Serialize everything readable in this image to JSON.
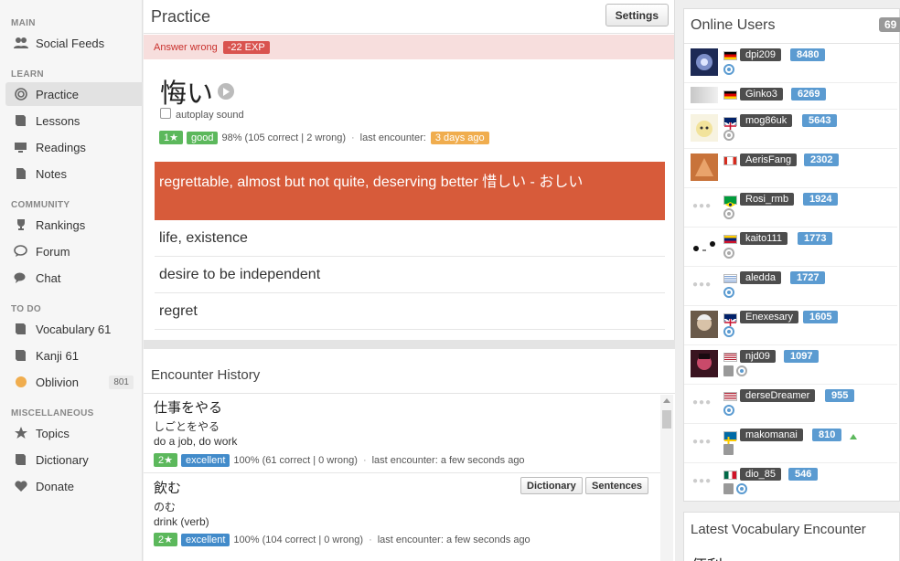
{
  "sidebar": {
    "sections": [
      {
        "title": "MAIN"
      },
      {
        "title": "LEARN"
      },
      {
        "title": "COMMUNITY"
      },
      {
        "title": "TO DO"
      },
      {
        "title": "MISCELLANEOUS"
      }
    ],
    "items": [
      {
        "label": "Social Feeds",
        "icon": "users-icon"
      },
      {
        "label": "Practice",
        "icon": "target-icon",
        "active": true
      },
      {
        "label": "Lessons",
        "icon": "book-icon"
      },
      {
        "label": "Readings",
        "icon": "monitor-icon"
      },
      {
        "label": "Notes",
        "icon": "document-icon"
      },
      {
        "label": "Rankings",
        "icon": "trophy-icon"
      },
      {
        "label": "Forum",
        "icon": "comment-icon"
      },
      {
        "label": "Chat",
        "icon": "comments-icon"
      },
      {
        "label": "Vocabulary 61",
        "icon": "book-icon"
      },
      {
        "label": "Kanji 61",
        "icon": "book-icon"
      },
      {
        "label": "Oblivion",
        "icon": "circle-icon",
        "count": "801"
      },
      {
        "label": "Topics",
        "icon": "star-icon"
      },
      {
        "label": "Dictionary",
        "icon": "book-icon"
      },
      {
        "label": "Donate",
        "icon": "heart-icon"
      }
    ]
  },
  "practice": {
    "title": "Practice",
    "settings_label": "Settings",
    "result_text": "Answer wrong",
    "exp_badge": "-22 EXP",
    "word": "悔い",
    "autoplay_label": "autoplay sound",
    "level_badge": "1★",
    "quality_badge": "good",
    "stats_text": "98% (105 correct | 2 wrong)",
    "last_label": "last encounter:",
    "last_value": "3 days ago",
    "answers": [
      {
        "text": "regrettable, almost but not quite, deserving better  惜しい - おしい",
        "correct": true
      },
      {
        "text": "life, existence"
      },
      {
        "text": "desire to be independent"
      },
      {
        "text": "regret"
      }
    ]
  },
  "history": {
    "title": "Encounter History",
    "items": [
      {
        "word": "仕事をやる",
        "reading": "しごとをやる",
        "meaning": "do a job, do work",
        "level": "2★",
        "quality": "excellent",
        "stats": "100% (61 correct | 0 wrong)",
        "last": "last encounter: a few seconds ago"
      },
      {
        "word": "飲む",
        "reading": "のむ",
        "meaning": "drink (verb)",
        "level": "2★",
        "quality": "excellent",
        "stats": "100% (104 correct | 0 wrong)",
        "last": "last encounter: a few seconds ago",
        "buttons": [
          "Dictionary",
          "Sentences"
        ]
      }
    ]
  },
  "online_users": {
    "title": "Online Users",
    "count": "69",
    "users": [
      {
        "name": "dpi209",
        "points": "8480",
        "flag": "de"
      },
      {
        "name": "Ginko3",
        "points": "6269",
        "flag": "de"
      },
      {
        "name": "mog86uk",
        "points": "5643",
        "flag": "gb"
      },
      {
        "name": "AerisFang",
        "points": "2302",
        "flag": "ca"
      },
      {
        "name": "Rosi_rmb",
        "points": "1924",
        "flag": "br"
      },
      {
        "name": "kaito111",
        "points": "1773",
        "flag": "ve"
      },
      {
        "name": "aledda",
        "points": "1727",
        "flag": "uy"
      },
      {
        "name": "Enexesary",
        "points": "1605",
        "flag": "gb"
      },
      {
        "name": "njd09",
        "points": "1097",
        "flag": "us"
      },
      {
        "name": "derseDreamer",
        "points": "955",
        "flag": "us"
      },
      {
        "name": "makomanai",
        "points": "810",
        "flag": "se"
      },
      {
        "name": "dio_85",
        "points": "546",
        "flag": "mx"
      }
    ]
  },
  "latest": {
    "title": "Latest Vocabulary Encounter",
    "word": "便利"
  },
  "colors": {
    "wrong_bg": "#f7dedd",
    "wrong_text": "#c9302c",
    "correct_answer_bg": "#d75b3a",
    "badge_green": "#5cb85c",
    "badge_blue": "#428bca",
    "badge_orange": "#f0ad4e",
    "points_blue": "#5b9bd1"
  }
}
